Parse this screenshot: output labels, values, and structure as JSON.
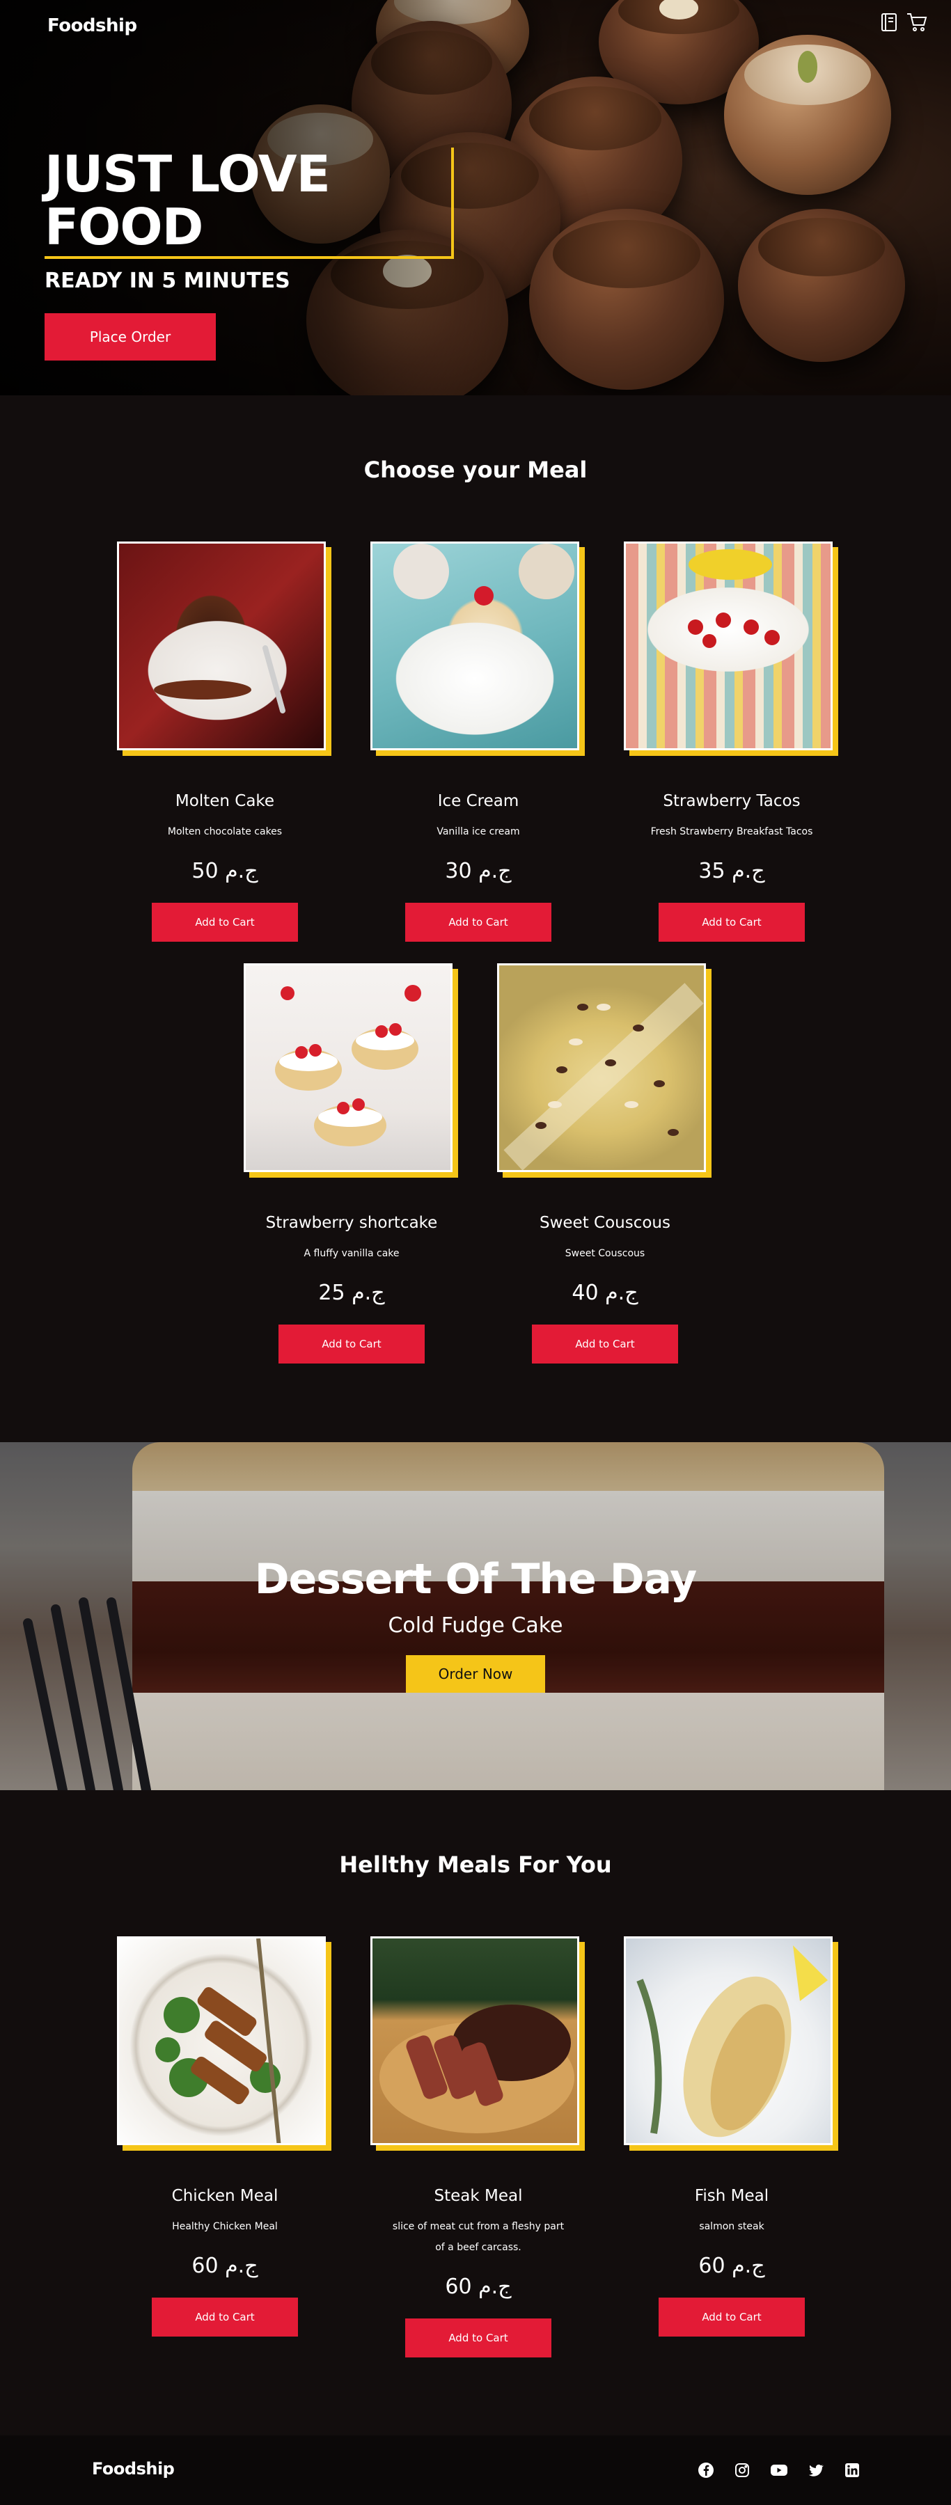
{
  "brand": "Foodship",
  "header_icons": [
    "menu-book-icon",
    "cart-icon"
  ],
  "hero": {
    "title_line1": "JUST LOVE",
    "title_line2": "FOOD",
    "subtitle": "READY IN 5 MINUTES",
    "button_label": "Place Order"
  },
  "meals": {
    "title": "Choose your Meal",
    "items": [
      {
        "name": "Molten Cake",
        "desc": "Molten chocolate cakes",
        "price": "50 ج.م",
        "button": "Add to Cart"
      },
      {
        "name": "Ice Cream",
        "desc": "Vanilla ice cream",
        "price": "30 ج.م",
        "button": "Add to Cart"
      },
      {
        "name": "Strawberry Tacos",
        "desc": "Fresh Strawberry Breakfast Tacos",
        "price": "35 ج.م",
        "button": "Add to Cart"
      },
      {
        "name": "Strawberry shortcake",
        "desc": "A fluffy vanilla cake",
        "price": "25 ج.م",
        "button": "Add to Cart"
      },
      {
        "name": "Sweet Couscous",
        "desc": "Sweet Couscous",
        "price": "40 ج.م",
        "button": "Add to Cart"
      }
    ]
  },
  "dessert": {
    "title": "Dessert Of The Day",
    "subtitle": "Cold Fudge Cake",
    "button_label": "Order Now"
  },
  "healthy": {
    "title": "Hellthy Meals For You",
    "items": [
      {
        "name": "Chicken Meal",
        "desc": "Healthy Chicken Meal",
        "price": "60 ج.م",
        "button": "Add to Cart"
      },
      {
        "name": "Steak Meal",
        "desc": "slice of meat cut from a fleshy part of a beef carcass.",
        "price": "60 ج.م",
        "button": "Add to Cart"
      },
      {
        "name": "Fish Meal",
        "desc": "salmon steak",
        "price": "60 ج.م",
        "button": "Add to Cart"
      }
    ]
  },
  "footer": {
    "brand": "Foodship",
    "socials": [
      "facebook-icon",
      "instagram-icon",
      "youtube-icon",
      "twitter-icon",
      "linkedin-icon"
    ]
  },
  "colors": {
    "accent_red": "#e31b36",
    "accent_yellow": "#f5c518",
    "background": "#120d0d"
  }
}
